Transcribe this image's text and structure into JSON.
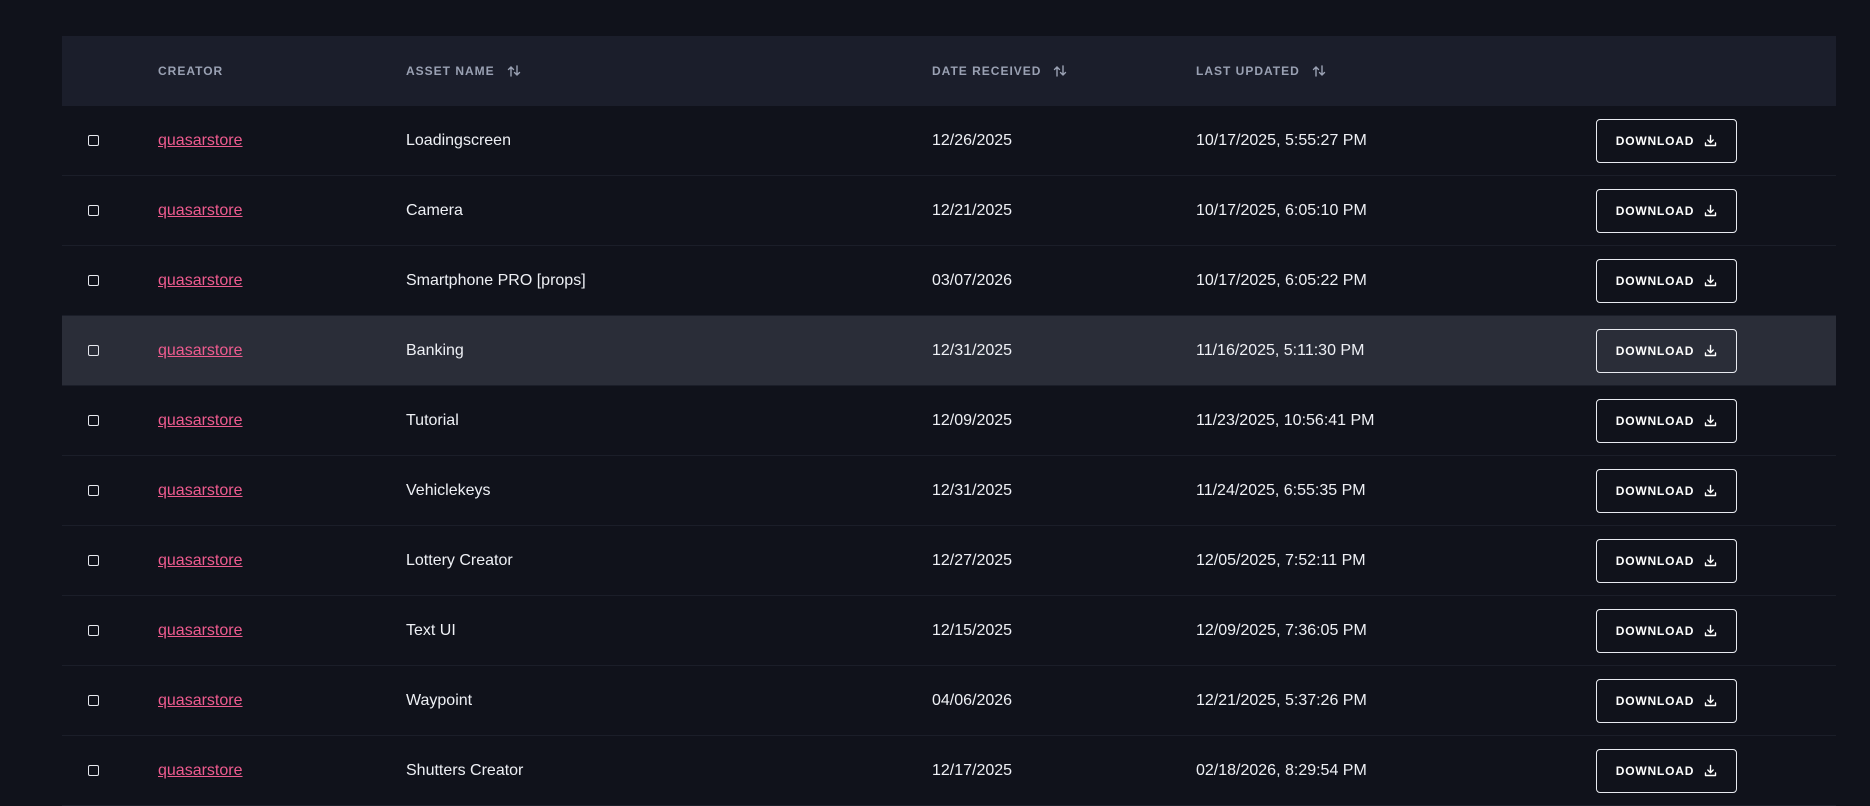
{
  "table": {
    "headers": {
      "creator": "CREATOR",
      "asset_name": "ASSET NAME",
      "date_received": "DATE RECEIVED",
      "last_updated": "LAST UPDATED"
    },
    "download_label": "DOWNLOAD",
    "colors": {
      "background": "#10121b",
      "header_bg": "#1b1e2b",
      "highlight_row": "#2a2d38",
      "creator_link": "#ef5b8f"
    },
    "rows": [
      {
        "creator": "quasarstore",
        "asset_name": "Loadingscreen",
        "date_received": "12/26/2025",
        "last_updated": "10/17/2025, 5:55:27 PM",
        "download": "DOWNLOAD"
      },
      {
        "creator": "quasarstore",
        "asset_name": "Camera",
        "date_received": "12/21/2025",
        "last_updated": "10/17/2025, 6:05:10 PM",
        "download": "DOWNLOAD"
      },
      {
        "creator": "quasarstore",
        "asset_name": "Smartphone PRO [props]",
        "date_received": "03/07/2026",
        "last_updated": "10/17/2025, 6:05:22 PM",
        "download": "DOWNLOAD"
      },
      {
        "creator": "quasarstore",
        "asset_name": "Banking",
        "date_received": "12/31/2025",
        "last_updated": "11/16/2025, 5:11:30 PM",
        "download": "DOWNLOAD",
        "highlighted": true
      },
      {
        "creator": "quasarstore",
        "asset_name": "Tutorial",
        "date_received": "12/09/2025",
        "last_updated": "11/23/2025, 10:56:41 PM",
        "download": "DOWNLOAD"
      },
      {
        "creator": "quasarstore",
        "asset_name": "Vehiclekeys",
        "date_received": "12/31/2025",
        "last_updated": "11/24/2025, 6:55:35 PM",
        "download": "DOWNLOAD"
      },
      {
        "creator": "quasarstore",
        "asset_name": "Lottery Creator",
        "date_received": "12/27/2025",
        "last_updated": "12/05/2025, 7:52:11 PM",
        "download": "DOWNLOAD"
      },
      {
        "creator": "quasarstore",
        "asset_name": "Text UI",
        "date_received": "12/15/2025",
        "last_updated": "12/09/2025, 7:36:05 PM",
        "download": "DOWNLOAD"
      },
      {
        "creator": "quasarstore",
        "asset_name": "Waypoint",
        "date_received": "04/06/2026",
        "last_updated": "12/21/2025, 5:37:26 PM",
        "download": "DOWNLOAD"
      },
      {
        "creator": "quasarstore",
        "asset_name": "Shutters Creator",
        "date_received": "12/17/2025",
        "last_updated": "02/18/2026, 8:29:54 PM",
        "download": "DOWNLOAD"
      }
    ]
  }
}
